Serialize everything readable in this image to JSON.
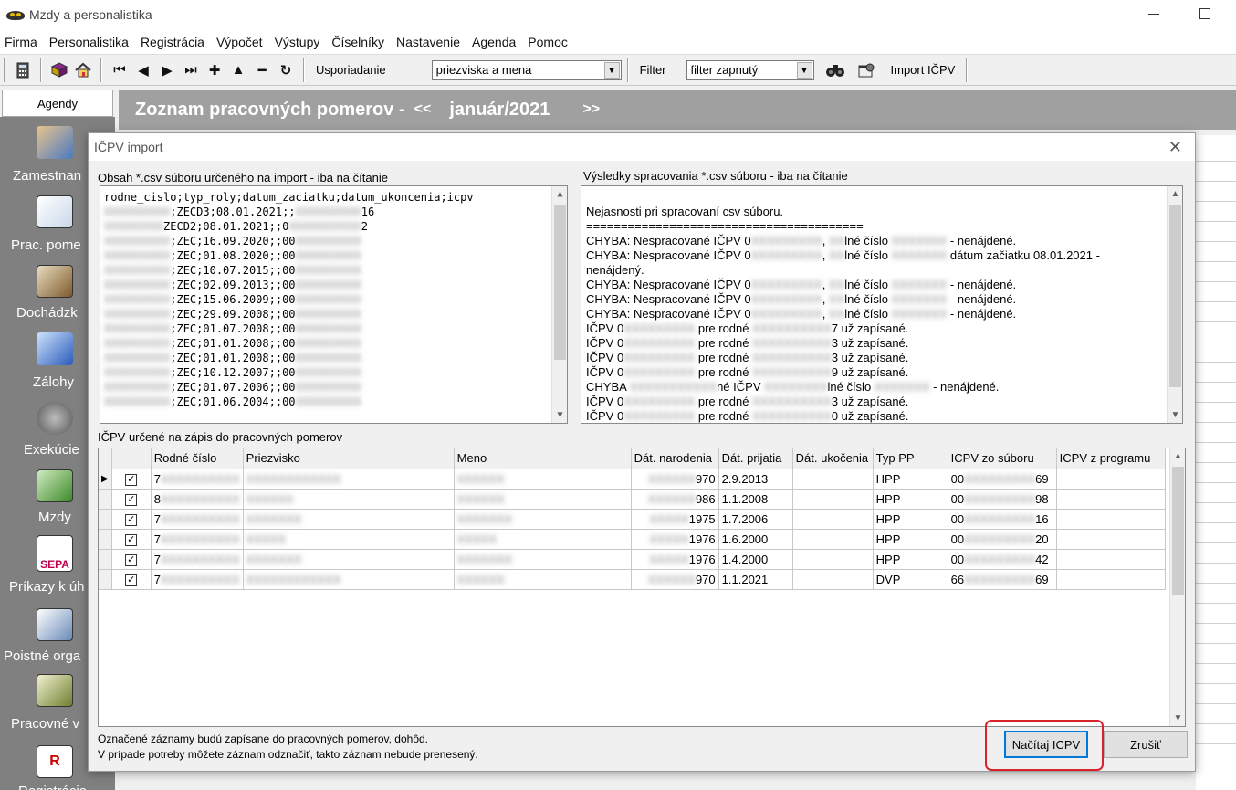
{
  "window": {
    "title": "Mzdy a personalistika"
  },
  "menu": [
    "Firma",
    "Personalistika",
    "Registrácia",
    "Výpočet",
    "Výstupy",
    "Číselníky",
    "Nastavenie",
    "Agenda",
    "Pomoc"
  ],
  "toolbar": {
    "sort_label": "Usporiadanie",
    "sort_value": "priezviska a mena",
    "filter_label": "Filter",
    "filter_value": "filter zapnutý",
    "import_label": "Import IČPV"
  },
  "sidebar": {
    "header": "Agendy",
    "items": [
      {
        "label": "Zamestnan",
        "icon": "employees-icon"
      },
      {
        "label": "Prac. pome",
        "icon": "work-relations-icon"
      },
      {
        "label": "Dochádzk",
        "icon": "attendance-icon"
      },
      {
        "label": "Zálohy",
        "icon": "advances-icon"
      },
      {
        "label": "Exekúcie",
        "icon": "execution-icon"
      },
      {
        "label": "Mzdy",
        "icon": "salaries-icon"
      },
      {
        "label": "Príkazy k úh",
        "icon": "sepa-icon",
        "badge": "SEPA"
      },
      {
        "label": "Poistné orga",
        "icon": "insurance-icon"
      },
      {
        "label": "Pracovné v",
        "icon": "work-calc-icon"
      },
      {
        "label": "Registrácie",
        "icon": "registration-icon",
        "badge": "R"
      }
    ]
  },
  "main": {
    "title": "Zoznam pracovných pomerov -",
    "prev": "<<",
    "period": "január/2021",
    "next": ">>"
  },
  "dialog": {
    "title": "IČPV import",
    "left_label": "Obsah *.csv súboru určeného na import - iba na čítanie",
    "right_label": "Výsledky spracovania *.csv súboru - iba na čítanie",
    "csv_lines": [
      {
        "pre": "",
        "text": "rodne_cislo;typ_roly;datum_zaciatku;datum_ukoncenia;icpv",
        "blur_pre": "",
        "blur_post": ""
      },
      {
        "pre": "XXXXXXXXXX",
        "text": ";ZECD3;08.01.2021;;",
        "blur_post": "XXXXXXXXXX",
        "post": "16"
      },
      {
        "pre": "XXXXXXXXX",
        "text": "ZECD2;08.01.2021;;0",
        "blur_post": "XXXXXXXXXXX",
        "post": "2"
      },
      {
        "pre": "XXXXXXXXXX",
        "text": ";ZEC;16.09.2020;;00",
        "blur_post": "XXXXXXXXXX",
        "post": ""
      },
      {
        "pre": "XXXXXXXXXX",
        "text": ";ZEC;01.08.2020;;00",
        "blur_post": "XXXXXXXXXX",
        "post": ""
      },
      {
        "pre": "XXXXXXXXXX",
        "text": ";ZEC;10.07.2015;;00",
        "blur_post": "XXXXXXXXXX",
        "post": ""
      },
      {
        "pre": "XXXXXXXXXX",
        "text": ";ZEC;02.09.2013;;00",
        "blur_post": "XXXXXXXXXX",
        "post": ""
      },
      {
        "pre": "XXXXXXXXXX",
        "text": ";ZEC;15.06.2009;;00",
        "blur_post": "XXXXXXXXXX",
        "post": ""
      },
      {
        "pre": "XXXXXXXXXX",
        "text": ";ZEC;29.09.2008;;00",
        "blur_post": "XXXXXXXXXX",
        "post": ""
      },
      {
        "pre": "XXXXXXXXXX",
        "text": ";ZEC;01.07.2008;;00",
        "blur_post": "XXXXXXXXXX",
        "post": ""
      },
      {
        "pre": "XXXXXXXXXX",
        "text": ";ZEC;01.01.2008;;00",
        "blur_post": "XXXXXXXXXX",
        "post": ""
      },
      {
        "pre": "XXXXXXXXXX",
        "text": ";ZEC;01.01.2008;;00",
        "blur_post": "XXXXXXXXXX",
        "post": ""
      },
      {
        "pre": "XXXXXXXXXX",
        "text": ";ZEC;10.12.2007;;00",
        "blur_post": "XXXXXXXXXX",
        "post": ""
      },
      {
        "pre": "XXXXXXXXXX",
        "text": ";ZEC;01.07.2006;;00",
        "blur_post": "XXXXXXXXXX",
        "post": ""
      },
      {
        "pre": "XXXXXXXXXX",
        "text": ";ZEC;01.06.2004;;00",
        "blur_post": "XXXXXXXXXX",
        "post": ""
      }
    ],
    "result_lines": [
      "",
      "Nejasnosti pri spracovaní csv súboru.",
      "========================================",
      "CHYBA: Nespracované IČPV 0█████████, ██lné číslo ███████ - nenájdené.",
      "CHYBA: Nespracované IČPV 0█████████, ██lné číslo ███████ dátum začiatku 08.01.2021 -",
      "nenájdený.",
      "CHYBA: Nespracované IČPV 0█████████, ██lné číslo ███████ - nenájdené.",
      "CHYBA: Nespracované IČPV 0█████████, ██lné číslo ███████ - nenájdené.",
      "CHYBA: Nespracované IČPV 0█████████, ██lné číslo ███████ - nenájdené.",
      "IČPV 0█████████ pre rodné ██████████7 už zapísané.",
      "IČPV 0█████████ pre rodné ██████████3 už zapísané.",
      "IČPV 0█████████ pre rodné ██████████3 už zapísané.",
      "IČPV 0█████████ pre rodné ██████████9 už zapísané.",
      "CHYBA ███████████né IČPV ████████lné číslo ███████ - nenájdené.",
      "IČPV 0█████████ pre rodné ██████████3 už zapísané.",
      "IČPV 0█████████ pre rodné ██████████0 už zapísané."
    ],
    "grid_label": "IČPV určené na zápis do pracovných pomerov",
    "columns": [
      "Rodné číslo",
      "Priezvisko",
      "Meno",
      "Dát. narodenia",
      "Dát. prijatia",
      "Dát. ukočenia",
      "Typ PP",
      "ICPV zo súboru",
      "ICPV z programu"
    ],
    "rows": [
      {
        "rc": "7██████████",
        "priezvisko": "████████████",
        "meno": "██████",
        "nar_pre": "██████",
        "nar": "970",
        "prijatie": "2.9.2013",
        "ukoncenie": "",
        "typ": "HPP",
        "icpv_pre": "00",
        "icpv_mid": "█████████",
        "icpv_post": "69",
        "icpv_prog": ""
      },
      {
        "rc": "8██████████",
        "priezvisko": "██████",
        "meno": "██████",
        "nar_pre": "██████",
        "nar": "986",
        "prijatie": "1.1.2008",
        "ukoncenie": "",
        "typ": "HPP",
        "icpv_pre": "00",
        "icpv_mid": "█████████",
        "icpv_post": "98",
        "icpv_prog": ""
      },
      {
        "rc": "7██████████",
        "priezvisko": "███████",
        "meno": "███████",
        "nar_pre": "█████",
        "nar": "1975",
        "prijatie": "1.7.2006",
        "ukoncenie": "",
        "typ": "HPP",
        "icpv_pre": "00",
        "icpv_mid": "█████████",
        "icpv_post": "16",
        "icpv_prog": ""
      },
      {
        "rc": "7██████████",
        "priezvisko": "█████",
        "meno": "█████",
        "nar_pre": "█████",
        "nar": "1976",
        "prijatie": "1.6.2000",
        "ukoncenie": "",
        "typ": "HPP",
        "icpv_pre": "00",
        "icpv_mid": "█████████",
        "icpv_post": "20",
        "icpv_prog": ""
      },
      {
        "rc": "7██████████",
        "priezvisko": "███████",
        "meno": "███████",
        "nar_pre": "█████",
        "nar": "1976",
        "prijatie": "1.4.2000",
        "ukoncenie": "",
        "typ": "HPP",
        "icpv_pre": "00",
        "icpv_mid": "█████████",
        "icpv_post": "42",
        "icpv_prog": ""
      },
      {
        "rc": "7██████████",
        "priezvisko": "████████████",
        "meno": "██████",
        "nar_pre": "██████",
        "nar": "970",
        "prijatie": "1.1.2021",
        "ukoncenie": "",
        "typ": "DVP",
        "icpv_pre": "66",
        "icpv_mid": "█████████",
        "icpv_post": "69",
        "icpv_prog": ""
      }
    ],
    "footer_line1": "Označené záznamy budú zapísane do pracovných pomerov, dohôd.",
    "footer_line2": "V prípade potreby môžete záznam odznačiť, takto záznam nebude prenesený.",
    "load_button": "Načítaj ICPV",
    "cancel_button": "Zrušiť"
  },
  "colors": {
    "highlight": "#d9232a",
    "sidebar": "#808080",
    "band": "#a0a0a0"
  }
}
